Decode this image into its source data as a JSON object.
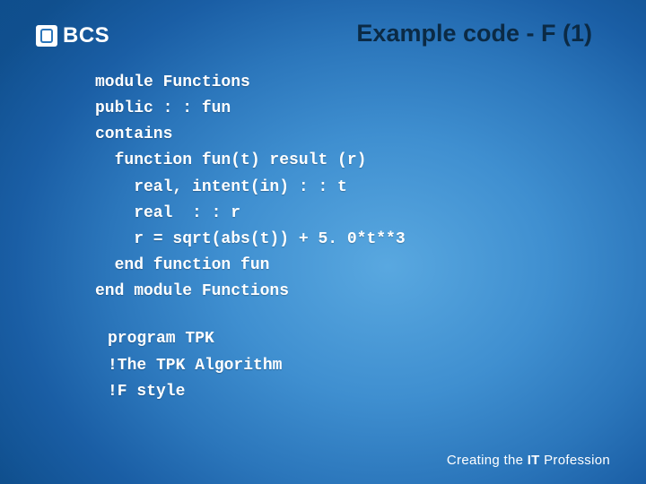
{
  "logo": {
    "text": "BCS"
  },
  "title": "Example code - F  (1)",
  "code": {
    "l1": "module Functions",
    "l2": "public : : fun",
    "l3": "contains",
    "l4": "  function fun(t) result (r)",
    "l5": "    real, intent(in) : : t",
    "l6": "    real  : : r",
    "l7": "    r = sqrt(abs(t)) + 5. 0*t**3",
    "l8": "  end function fun",
    "l9": "end module Functions",
    "p1": "program TPK",
    "p2": "!The TPK Algorithm",
    "p3": "!F style"
  },
  "footer": {
    "prefix": "Creating the ",
    "bold": "IT",
    "suffix": " Profession"
  }
}
